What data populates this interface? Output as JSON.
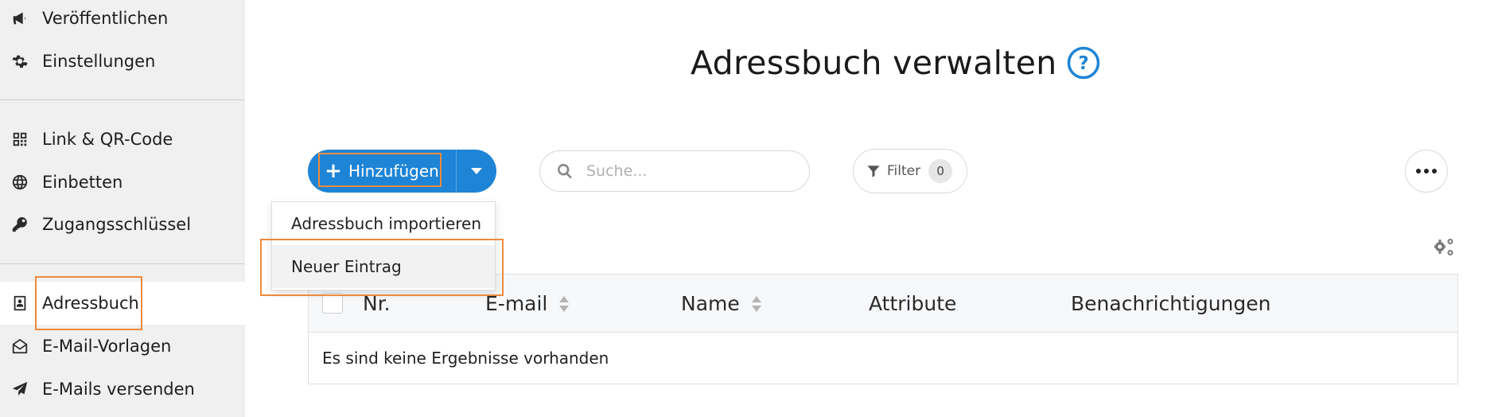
{
  "sidebar": {
    "items": [
      {
        "label": "Veröffentlichen",
        "icon": "megaphone-icon"
      },
      {
        "label": "Einstellungen",
        "icon": "gear-icon"
      },
      {
        "label": "Link & QR-Code",
        "icon": "qr-code-icon"
      },
      {
        "label": "Einbetten",
        "icon": "globe-icon"
      },
      {
        "label": "Zugangsschlüssel",
        "icon": "key-icon"
      },
      {
        "label": "Adressbuch",
        "icon": "address-book-icon",
        "active": true
      },
      {
        "label": "E-Mail-Vorlagen",
        "icon": "envelope-open-icon"
      },
      {
        "label": "E-Mails versenden",
        "icon": "paper-plane-icon"
      }
    ]
  },
  "page": {
    "title": "Adressbuch verwalten",
    "help_icon": "question-circle-icon"
  },
  "toolbar": {
    "add_label": "Hinzufügen",
    "search_placeholder": "Suche...",
    "filter_label": "Filter",
    "filter_count": "0"
  },
  "dropdown": {
    "items": [
      "Adressbuch importieren",
      "Neuer Eintrag"
    ]
  },
  "table": {
    "columns": [
      "Nr.",
      "E-mail",
      "Name",
      "Attribute",
      "Benachrichtigungen"
    ],
    "empty_message": "Es sind keine Ergebnisse vorhanden"
  },
  "colors": {
    "primary": "#1e84d6",
    "highlight": "#ee8a3c",
    "sidebar_bg": "#f0f0f0"
  }
}
